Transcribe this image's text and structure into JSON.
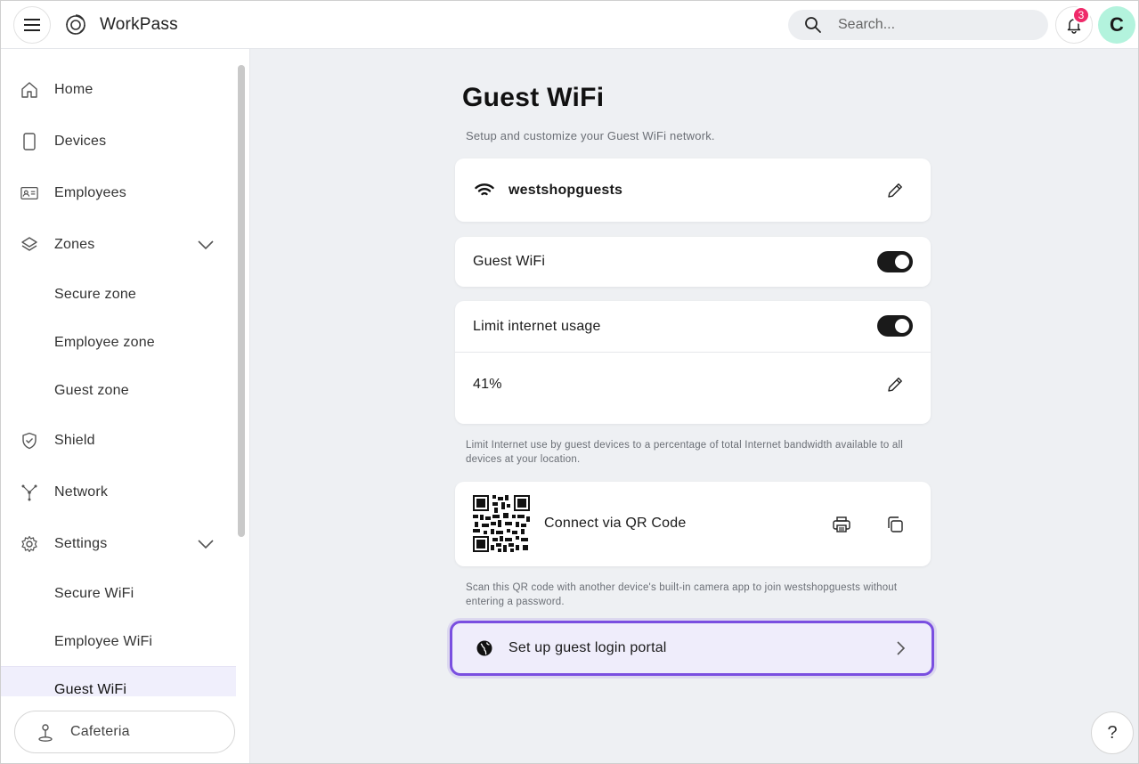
{
  "header": {
    "brand": "WorkPass",
    "search_placeholder": "Search...",
    "notification_count": "3",
    "avatar_initial": "C"
  },
  "sidebar": {
    "items": [
      {
        "label": "Home",
        "icon": "home-icon"
      },
      {
        "label": "Devices",
        "icon": "phone-icon"
      },
      {
        "label": "Employees",
        "icon": "id-card-icon"
      },
      {
        "label": "Zones",
        "icon": "layers-icon",
        "expandable": true
      },
      {
        "label": "Secure zone"
      },
      {
        "label": "Employee zone"
      },
      {
        "label": "Guest zone"
      },
      {
        "label": "Shield",
        "icon": "shield-icon"
      },
      {
        "label": "Network",
        "icon": "network-icon"
      },
      {
        "label": "Settings",
        "icon": "gear-icon",
        "expandable": true
      },
      {
        "label": "Secure WiFi"
      },
      {
        "label": "Employee WiFi"
      },
      {
        "label": "Guest WiFi",
        "active": true
      }
    ],
    "location": "Cafeteria"
  },
  "main": {
    "title": "Guest WiFi",
    "subtitle": "Setup and customize your Guest WiFi network.",
    "ssid": "westshopguests",
    "guest_wifi_label": "Guest WiFi",
    "guest_wifi_enabled": true,
    "limit_label": "Limit internet usage",
    "limit_enabled": true,
    "limit_value": "41%",
    "limit_helper": "Limit Internet use by guest devices to a percentage of total Internet bandwidth available to all devices at your location.",
    "qr_label": "Connect via QR Code",
    "qr_helper": "Scan this QR code with another device's built-in camera app to join westshopguests without entering a password.",
    "portal_label": "Set up guest login portal",
    "help_label": "?"
  },
  "colors": {
    "accent": "#7a4fe0",
    "badge": "#ef2a6a",
    "avatar": "#b3f3dd",
    "toggle_on": "#1a1a1a"
  }
}
